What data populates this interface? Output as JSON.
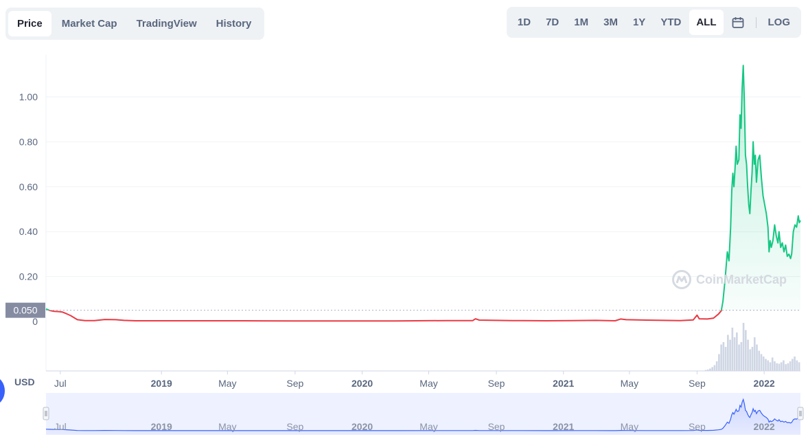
{
  "tabs": [
    {
      "label": "Price",
      "active": true
    },
    {
      "label": "Market Cap",
      "active": false
    },
    {
      "label": "TradingView",
      "active": false
    },
    {
      "label": "History",
      "active": false
    }
  ],
  "ranges": [
    {
      "label": "1D",
      "active": false
    },
    {
      "label": "7D",
      "active": false
    },
    {
      "label": "1M",
      "active": false
    },
    {
      "label": "3M",
      "active": false
    },
    {
      "label": "1Y",
      "active": false
    },
    {
      "label": "YTD",
      "active": false
    },
    {
      "label": "ALL",
      "active": true
    }
  ],
  "log_label": "LOG",
  "currency_label": "USD",
  "watermark": "CoinMarketCap",
  "colors": {
    "down": "#ea3943",
    "up": "#16c784",
    "up_fill": "#16c784",
    "volume": "#cfd6e4",
    "navigator_line": "#3861fb",
    "navigator_bg": "#eef1ff",
    "current_price_label_bg": "#858ca2"
  },
  "chart_data": {
    "type": "line",
    "xlabel": "",
    "ylabel": "",
    "ylim": [
      0,
      1.16
    ],
    "yticks": [
      {
        "value": 0,
        "label": "0"
      },
      {
        "value": 0.2,
        "label": "0.20"
      },
      {
        "value": 0.4,
        "label": "0.40"
      },
      {
        "value": 0.6,
        "label": "0.60"
      },
      {
        "value": 0.8,
        "label": "0.80"
      },
      {
        "value": 1.0,
        "label": "1.00"
      }
    ],
    "reference_price": 0.05,
    "reference_label": "0.050",
    "xticks": [
      {
        "date": "2018-07-01",
        "label": "Jul",
        "bold": false
      },
      {
        "date": "2019-01-01",
        "label": "2019",
        "bold": true
      },
      {
        "date": "2019-05-01",
        "label": "May",
        "bold": false
      },
      {
        "date": "2019-09-01",
        "label": "Sep",
        "bold": false
      },
      {
        "date": "2020-01-01",
        "label": "2020",
        "bold": true
      },
      {
        "date": "2020-05-01",
        "label": "May",
        "bold": false
      },
      {
        "date": "2020-09-01",
        "label": "Sep",
        "bold": false
      },
      {
        "date": "2021-01-01",
        "label": "2021",
        "bold": true
      },
      {
        "date": "2021-05-01",
        "label": "May",
        "bold": false
      },
      {
        "date": "2021-09-01",
        "label": "Sep",
        "bold": false
      },
      {
        "date": "2022-01-01",
        "label": "2022",
        "bold": true
      }
    ],
    "x_range": [
      "2018-06-05",
      "2022-03-08"
    ],
    "series": [
      {
        "points": [
          [
            "2018-06-05",
            0.056
          ],
          [
            "2018-06-12",
            0.049
          ],
          [
            "2018-06-20",
            0.045
          ],
          [
            "2018-06-28",
            0.044
          ],
          [
            "2018-07-05",
            0.042
          ],
          [
            "2018-07-12",
            0.035
          ],
          [
            "2018-07-20",
            0.026
          ],
          [
            "2018-08-01",
            0.008
          ],
          [
            "2018-08-15",
            0.004
          ],
          [
            "2018-09-01",
            0.004
          ],
          [
            "2018-09-20",
            0.009
          ],
          [
            "2018-10-10",
            0.008
          ],
          [
            "2018-10-25",
            0.005
          ],
          [
            "2018-11-15",
            0.003
          ],
          [
            "2018-12-15",
            0.003
          ],
          [
            "2019-03-01",
            0.003
          ],
          [
            "2019-06-01",
            0.003
          ],
          [
            "2019-09-01",
            0.002
          ],
          [
            "2019-12-01",
            0.002
          ],
          [
            "2020-03-01",
            0.002
          ],
          [
            "2020-06-01",
            0.004
          ],
          [
            "2020-07-20",
            0.004
          ],
          [
            "2020-07-25",
            0.012
          ],
          [
            "2020-08-01",
            0.006
          ],
          [
            "2020-10-01",
            0.004
          ],
          [
            "2020-12-01",
            0.003
          ],
          [
            "2021-01-15",
            0.004
          ],
          [
            "2021-03-01",
            0.005
          ],
          [
            "2021-04-05",
            0.003
          ],
          [
            "2021-04-15",
            0.011
          ],
          [
            "2021-04-25",
            0.008
          ],
          [
            "2021-06-01",
            0.006
          ],
          [
            "2021-08-01",
            0.004
          ],
          [
            "2021-08-25",
            0.007
          ],
          [
            "2021-09-01",
            0.028
          ],
          [
            "2021-09-05",
            0.012
          ],
          [
            "2021-09-20",
            0.011
          ],
          [
            "2021-10-01",
            0.015
          ],
          [
            "2021-10-10",
            0.033
          ],
          [
            "2021-10-15",
            0.048
          ],
          [
            "2021-10-18",
            0.09
          ],
          [
            "2021-10-22",
            0.19
          ],
          [
            "2021-10-26",
            0.31
          ],
          [
            "2021-10-29",
            0.27
          ],
          [
            "2021-11-01",
            0.42
          ],
          [
            "2021-11-03",
            0.58
          ],
          [
            "2021-11-05",
            0.66
          ],
          [
            "2021-11-07",
            0.6
          ],
          [
            "2021-11-09",
            0.68
          ],
          [
            "2021-11-11",
            0.78
          ],
          [
            "2021-11-13",
            0.7
          ],
          [
            "2021-11-16",
            0.72
          ],
          [
            "2021-11-18",
            0.92
          ],
          [
            "2021-11-20",
            0.86
          ],
          [
            "2021-11-22",
            1.04
          ],
          [
            "2021-11-24",
            1.14
          ],
          [
            "2021-11-26",
            0.98
          ],
          [
            "2021-11-28",
            0.74
          ],
          [
            "2021-11-30",
            0.7
          ],
          [
            "2021-12-02",
            0.6
          ],
          [
            "2021-12-04",
            0.52
          ],
          [
            "2021-12-06",
            0.48
          ],
          [
            "2021-12-08",
            0.58
          ],
          [
            "2021-12-10",
            0.66
          ],
          [
            "2021-12-12",
            0.8
          ],
          [
            "2021-12-14",
            0.7
          ],
          [
            "2021-12-16",
            0.74
          ],
          [
            "2021-12-18",
            0.62
          ],
          [
            "2021-12-21",
            0.72
          ],
          [
            "2021-12-24",
            0.74
          ],
          [
            "2021-12-27",
            0.64
          ],
          [
            "2021-12-30",
            0.56
          ],
          [
            "2022-01-02",
            0.52
          ],
          [
            "2022-01-05",
            0.48
          ],
          [
            "2022-01-08",
            0.42
          ],
          [
            "2022-01-10",
            0.31
          ],
          [
            "2022-01-12",
            0.36
          ],
          [
            "2022-01-14",
            0.33
          ],
          [
            "2022-01-17",
            0.36
          ],
          [
            "2022-01-20",
            0.43
          ],
          [
            "2022-01-23",
            0.38
          ],
          [
            "2022-01-26",
            0.35
          ],
          [
            "2022-01-28",
            0.4
          ],
          [
            "2022-01-31",
            0.33
          ],
          [
            "2022-02-03",
            0.35
          ],
          [
            "2022-02-06",
            0.31
          ],
          [
            "2022-02-09",
            0.34
          ],
          [
            "2022-02-12",
            0.29
          ],
          [
            "2022-02-15",
            0.3
          ],
          [
            "2022-02-18",
            0.28
          ],
          [
            "2022-02-20",
            0.3
          ],
          [
            "2022-02-23",
            0.4
          ],
          [
            "2022-02-26",
            0.43
          ],
          [
            "2022-03-01",
            0.42
          ],
          [
            "2022-03-04",
            0.47
          ],
          [
            "2022-03-06",
            0.44
          ],
          [
            "2022-03-08",
            0.45
          ]
        ]
      }
    ],
    "volume": {
      "start": "2021-09-15",
      "end": "2022-03-08",
      "relative_values": [
        0.02,
        0.03,
        0.05,
        0.08,
        0.12,
        0.2,
        0.35,
        0.55,
        0.6,
        0.5,
        0.75,
        0.65,
        0.9,
        0.7,
        0.8,
        0.55,
        0.6,
        1.0,
        0.85,
        0.65,
        0.45,
        0.5,
        0.7,
        0.55,
        0.42,
        0.35,
        0.3,
        0.25,
        0.22,
        0.18,
        0.28,
        0.2,
        0.16,
        0.15,
        0.18,
        0.22,
        0.14,
        0.16,
        0.2,
        0.25,
        0.3,
        0.22,
        0.18
      ]
    },
    "navigator": {
      "xticks": [
        "Jul",
        "2019",
        "May",
        "Sep",
        "2020",
        "May",
        "Sep",
        "2021",
        "May",
        "Sep",
        "2022"
      ]
    }
  }
}
